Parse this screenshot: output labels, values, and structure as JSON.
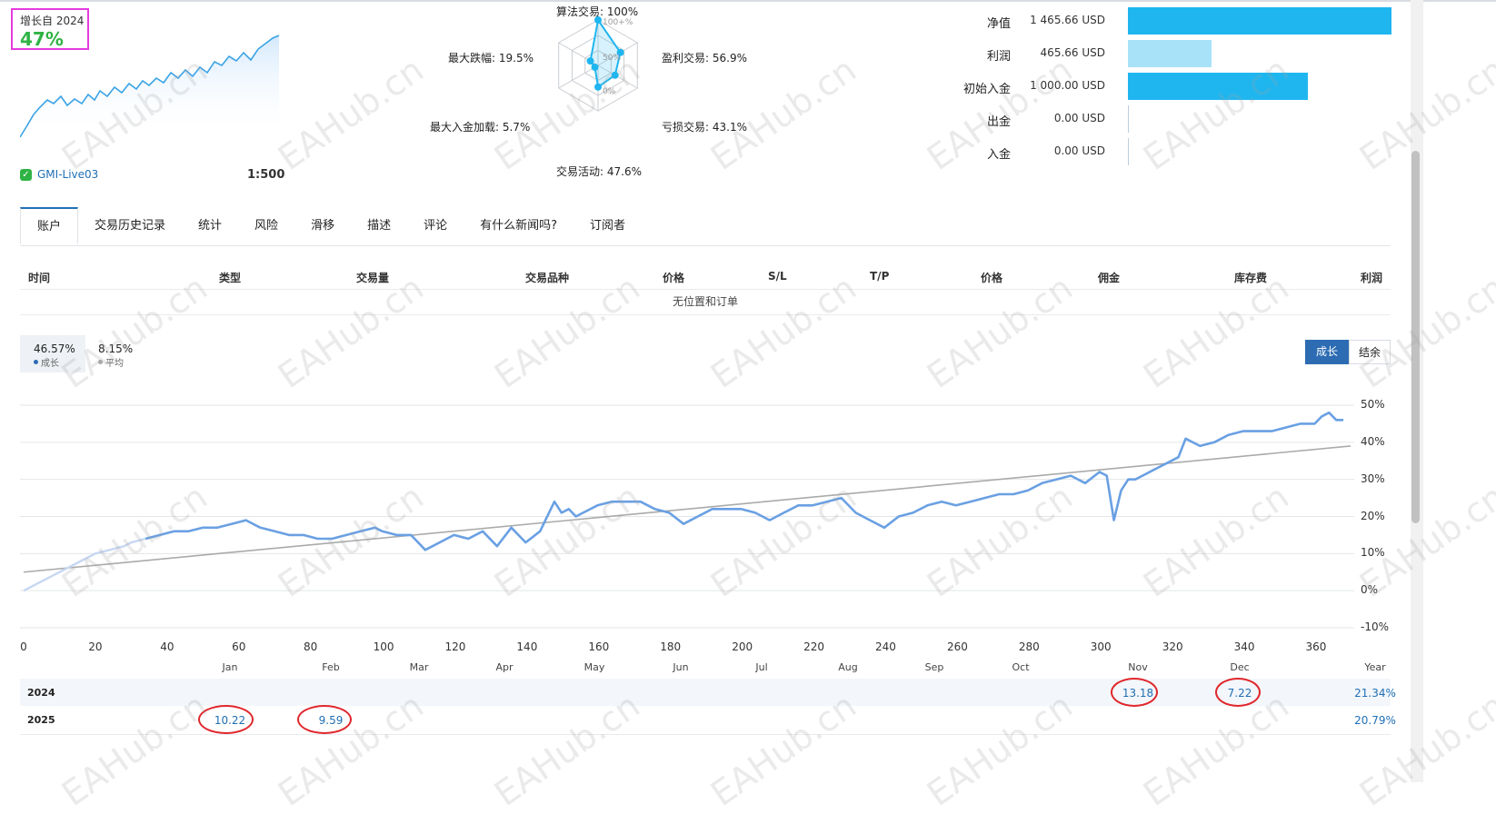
{
  "growth": {
    "label": "增长自 2024",
    "value": "47%",
    "account": "GMI-Live03",
    "leverage": "1:500"
  },
  "radar": {
    "labels": [
      "算法交易: 100%",
      "盈利交易: 56.9%",
      "亏损交易: 43.1%",
      "交易活动: 47.6%",
      "最大入金加载: 5.7%",
      "最大跌幅: 19.5%"
    ],
    "values": [
      100,
      56.9,
      43.1,
      47.6,
      5.7,
      19.5
    ],
    "rings": [
      "100+%",
      "50%",
      "0%"
    ]
  },
  "balances": [
    {
      "label": "净值",
      "value": "1 465.66 USD",
      "fraction": 1.0,
      "color": "#1fb6f0"
    },
    {
      "label": "利润",
      "value": "465.66 USD",
      "fraction": 0.318,
      "color": "#a8e2f8"
    },
    {
      "label": "初始入金",
      "value": "1 000.00 USD",
      "fraction": 0.682,
      "color": "#1fb6f0"
    },
    {
      "label": "出金",
      "value": "0.00 USD",
      "fraction": 0,
      "color": "#1fb6f0"
    },
    {
      "label": "入金",
      "value": "0.00 USD",
      "fraction": 0,
      "color": "#1fb6f0"
    }
  ],
  "tabs": [
    "账户",
    "交易历史记录",
    "统计",
    "风险",
    "滑移",
    "描述",
    "评论",
    "有什么新闻吗?",
    "订阅者"
  ],
  "positions": {
    "columns": [
      "时间",
      "类型",
      "交易量",
      "交易品种",
      "价格",
      "S/L",
      "T/P",
      "价格",
      "佣金",
      "库存费",
      "利润"
    ],
    "empty_text": "无位置和订单"
  },
  "stats": {
    "growth_value": "46.57%",
    "growth_label": "成长",
    "avg_value": "8.15%",
    "avg_label": "平均"
  },
  "toggle": {
    "on": "成长",
    "off": "结余"
  },
  "chart_data": {
    "type": "line",
    "x_ticks": [
      0,
      20,
      40,
      60,
      80,
      100,
      120,
      140,
      160,
      180,
      200,
      220,
      240,
      260,
      280,
      300,
      320,
      340,
      360
    ],
    "y_ticks": [
      "50%",
      "40%",
      "30%",
      "20%",
      "10%",
      "0%",
      "-10%"
    ],
    "ylim": [
      -10,
      50
    ],
    "xlim": [
      0,
      370
    ],
    "months": [
      "Jan",
      "Feb",
      "Mar",
      "Apr",
      "May",
      "Jun",
      "Jul",
      "Aug",
      "Sep",
      "Oct",
      "Nov",
      "Dec",
      "Year"
    ],
    "series": [
      {
        "x": [
          0,
          4,
          8,
          12,
          16,
          20,
          24,
          28,
          30,
          34,
          38,
          42,
          46,
          50,
          54,
          58,
          62,
          66,
          70,
          74,
          78,
          82,
          86,
          90,
          94,
          98,
          100,
          104,
          108,
          112,
          116,
          120,
          124,
          128,
          132,
          136,
          140,
          144,
          148,
          150,
          152,
          154,
          156,
          160,
          164,
          168,
          172,
          176,
          180,
          184,
          188,
          192,
          196,
          200,
          204,
          208,
          212,
          216,
          220,
          224,
          228,
          232,
          236,
          240,
          244,
          248,
          252,
          256,
          260,
          264,
          268,
          272,
          276,
          280,
          284,
          288,
          292,
          296,
          300,
          302,
          304,
          306,
          308,
          310,
          312,
          316,
          320,
          322,
          324,
          328,
          332,
          336,
          340,
          344,
          348,
          352,
          356,
          360,
          362,
          364,
          366,
          368
        ],
        "y": [
          0,
          2,
          4,
          6,
          8,
          10,
          11,
          12,
          13,
          14,
          15,
          16,
          16,
          17,
          17,
          18,
          19,
          17,
          16,
          15,
          15,
          14,
          14,
          15,
          16,
          17,
          16,
          15,
          15,
          11,
          13,
          15,
          14,
          16,
          12,
          17,
          13,
          16,
          24,
          21,
          22,
          20,
          21,
          23,
          24,
          24,
          24,
          22,
          21,
          18,
          20,
          22,
          22,
          22,
          21,
          19,
          21,
          23,
          23,
          24,
          25,
          21,
          19,
          17,
          20,
          21,
          23,
          24,
          23,
          24,
          25,
          26,
          26,
          27,
          29,
          30,
          31,
          29,
          32,
          31,
          19,
          27,
          30,
          30,
          31,
          33,
          35,
          36,
          41,
          39,
          40,
          42,
          43,
          43,
          43,
          44,
          45,
          45,
          47,
          48,
          46,
          46
        ]
      }
    ],
    "trend": {
      "x": [
        0,
        370
      ],
      "y": [
        5,
        39
      ]
    },
    "monthly": {
      "2024": {
        "Nov": "13.18",
        "Dec": "7.22",
        "Year": "21.34%"
      },
      "2025": {
        "Jan": "10.22",
        "Feb": "9.59",
        "Year": "20.79%"
      }
    },
    "years": [
      "2024",
      "2025"
    ],
    "colors": {
      "line": "#6aa0e3",
      "trend": "#aaaaaa",
      "grid": "#e3e6ea"
    }
  }
}
